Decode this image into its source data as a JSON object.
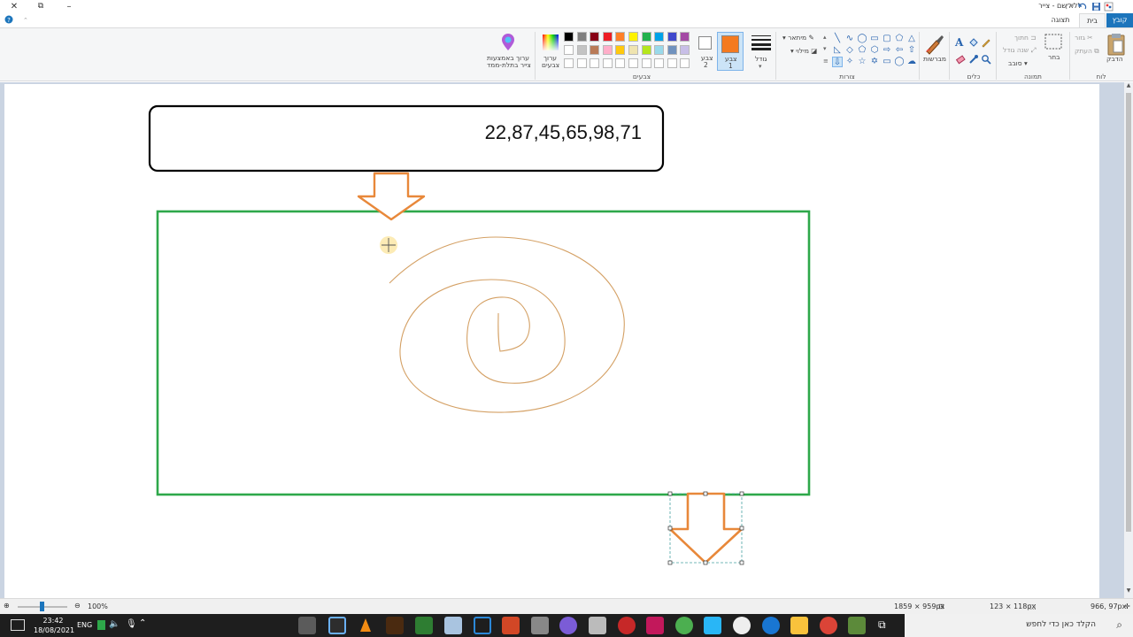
{
  "window": {
    "title": "ללא שם - צייר"
  },
  "tabs": [
    {
      "label": "קובץ"
    },
    {
      "label": "בית"
    },
    {
      "label": "תצוגה"
    }
  ],
  "ribbon": {
    "clipboard": {
      "group_label": "לוח",
      "paste": "הדבק",
      "cut": "גזור",
      "copy": "העתק"
    },
    "image": {
      "group_label": "תמונה",
      "select": "בחר",
      "crop": "חתוך",
      "resize": "שנה גודל",
      "rotate": "סובב"
    },
    "tools": {
      "group_label": "כלים"
    },
    "brushes": {
      "label": "מברשות"
    },
    "shapes": {
      "group_label": "צורות",
      "outline": "מיתאר",
      "fill": "מילוי"
    },
    "size": {
      "label": "גודל"
    },
    "color1": {
      "label_line1": "צבע",
      "label_line2": "1",
      "value": "#f47a20"
    },
    "color2": {
      "label_line1": "צבע",
      "label_line2": "2",
      "value": "#ffffff"
    },
    "colors": {
      "group_label": "צבעים",
      "edit_line1": "ערוך",
      "edit_line2": "צבעים",
      "palette_row1": [
        "#000000",
        "#7f7f7f",
        "#880015",
        "#ed1c24",
        "#ff7f27",
        "#fff200",
        "#22b14c",
        "#00a2e8",
        "#3f48cc",
        "#a349a4"
      ],
      "palette_row2": [
        "#ffffff",
        "#c3c3c3",
        "#b97a57",
        "#ffaec9",
        "#ffc90e",
        "#efe4b0",
        "#b5e61d",
        "#99d9ea",
        "#7092be",
        "#c8bfe7"
      ],
      "palette_row3": [
        "#ffffff",
        "#ffffff",
        "#ffffff",
        "#ffffff",
        "#ffffff",
        "#ffffff",
        "#ffffff",
        "#ffffff",
        "#ffffff",
        "#ffffff"
      ]
    },
    "paint3d": {
      "line1": "ערוך באמצעות",
      "line2": "צייר בתלת-ממד"
    }
  },
  "canvas": {
    "text_box": "22,87,45,65,98,71",
    "colors": {
      "orange": "#e8883a",
      "green": "#2ea84a",
      "spiral": "#d4a064"
    }
  },
  "statusbar": {
    "cursor_pos": "966, 97px",
    "selection_size": "123 × 118px",
    "canvas_size": "1859 × 959px",
    "zoom": "100%"
  },
  "taskbar": {
    "time": "23:42",
    "date": "18/08/2021",
    "lang": "ENG",
    "search_placeholder": "הקלד כאן כדי לחפש"
  }
}
